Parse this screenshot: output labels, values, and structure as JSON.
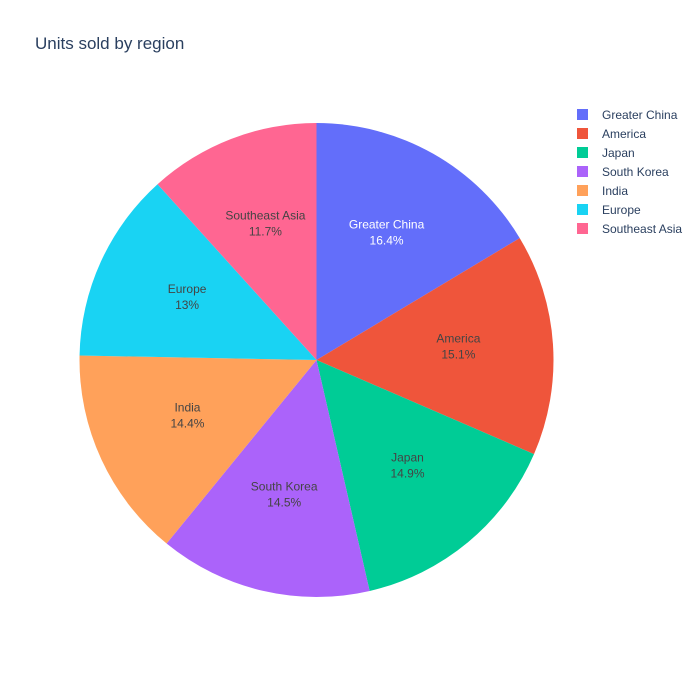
{
  "title": "Units sold by region",
  "chart_data": {
    "type": "pie",
    "title": "Units sold by region",
    "categories": [
      "Greater China",
      "America",
      "Japan",
      "South Korea",
      "India",
      "Europe",
      "Southeast Asia"
    ],
    "values": [
      16.4,
      15.1,
      14.9,
      14.5,
      14.4,
      13.0,
      11.7
    ],
    "percent_labels": [
      "16.4%",
      "15.1%",
      "14.9%",
      "14.5%",
      "14.4%",
      "13%",
      "11.7%"
    ],
    "colors": [
      "#636efa",
      "#EF553B",
      "#00cc96",
      "#ab63fa",
      "#FFA15A",
      "#19d3f3",
      "#FF6692"
    ],
    "label_colors": [
      "#ffffff",
      "#444444",
      "#444444",
      "#444444",
      "#444444",
      "#444444",
      "#444444"
    ],
    "direction": "clockwise",
    "start_angle_deg": 0,
    "legend_position": "top-right"
  }
}
